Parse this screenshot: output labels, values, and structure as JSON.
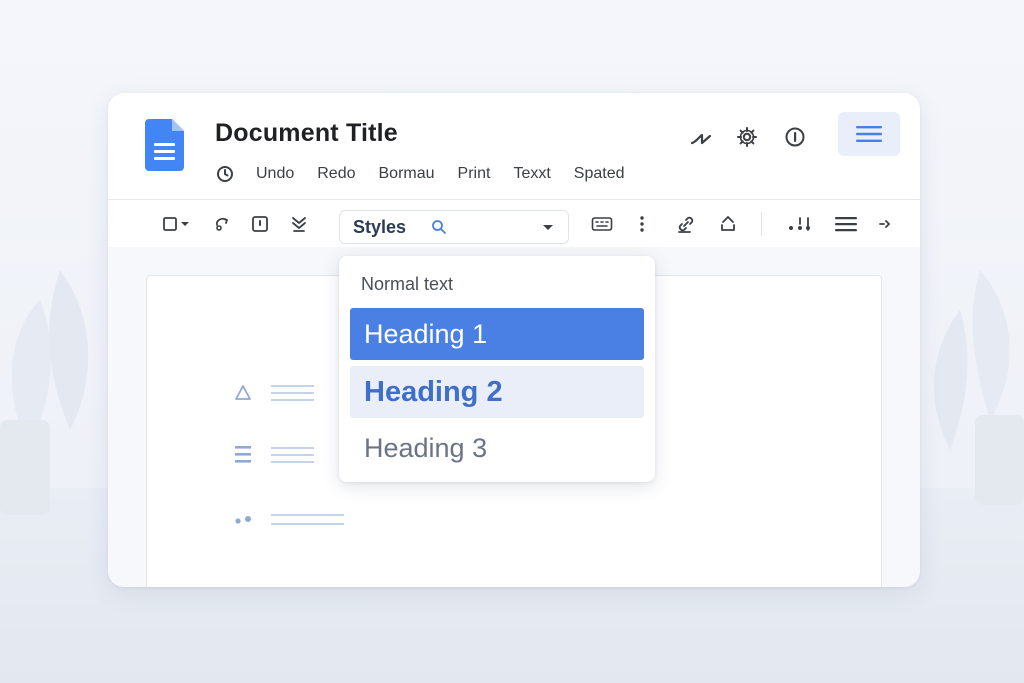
{
  "document": {
    "title": "Document Title"
  },
  "menu": {
    "items": [
      "Undo",
      "Redo",
      "Bormau",
      "Print",
      "Texxt",
      "Spated"
    ]
  },
  "toolbar": {
    "styles_label": "Styles"
  },
  "styles_dropdown": {
    "options": [
      "Normal text",
      "Heading 1",
      "Heading 2",
      "Heading 3"
    ],
    "selected": "Heading 1"
  },
  "icons": {
    "header": [
      "clock-icon",
      "signature-icon",
      "settings-gear-icon",
      "info-icon",
      "hamburger-menu-icon"
    ],
    "toolbar": [
      "checkbox-icon",
      "paint-format-icon",
      "comment-icon",
      "merge-icon",
      "search-icon",
      "chevron-down-icon",
      "keyboard-icon",
      "more-vertical-icon",
      "link-icon",
      "upload-icon",
      "align-icon",
      "list-lines-icon",
      "expand-icon"
    ]
  },
  "colors": {
    "accent": "#4a80e4",
    "accent_light": "#e9eef8",
    "doc_icon": "#4285f4",
    "text_dark": "#202124"
  }
}
